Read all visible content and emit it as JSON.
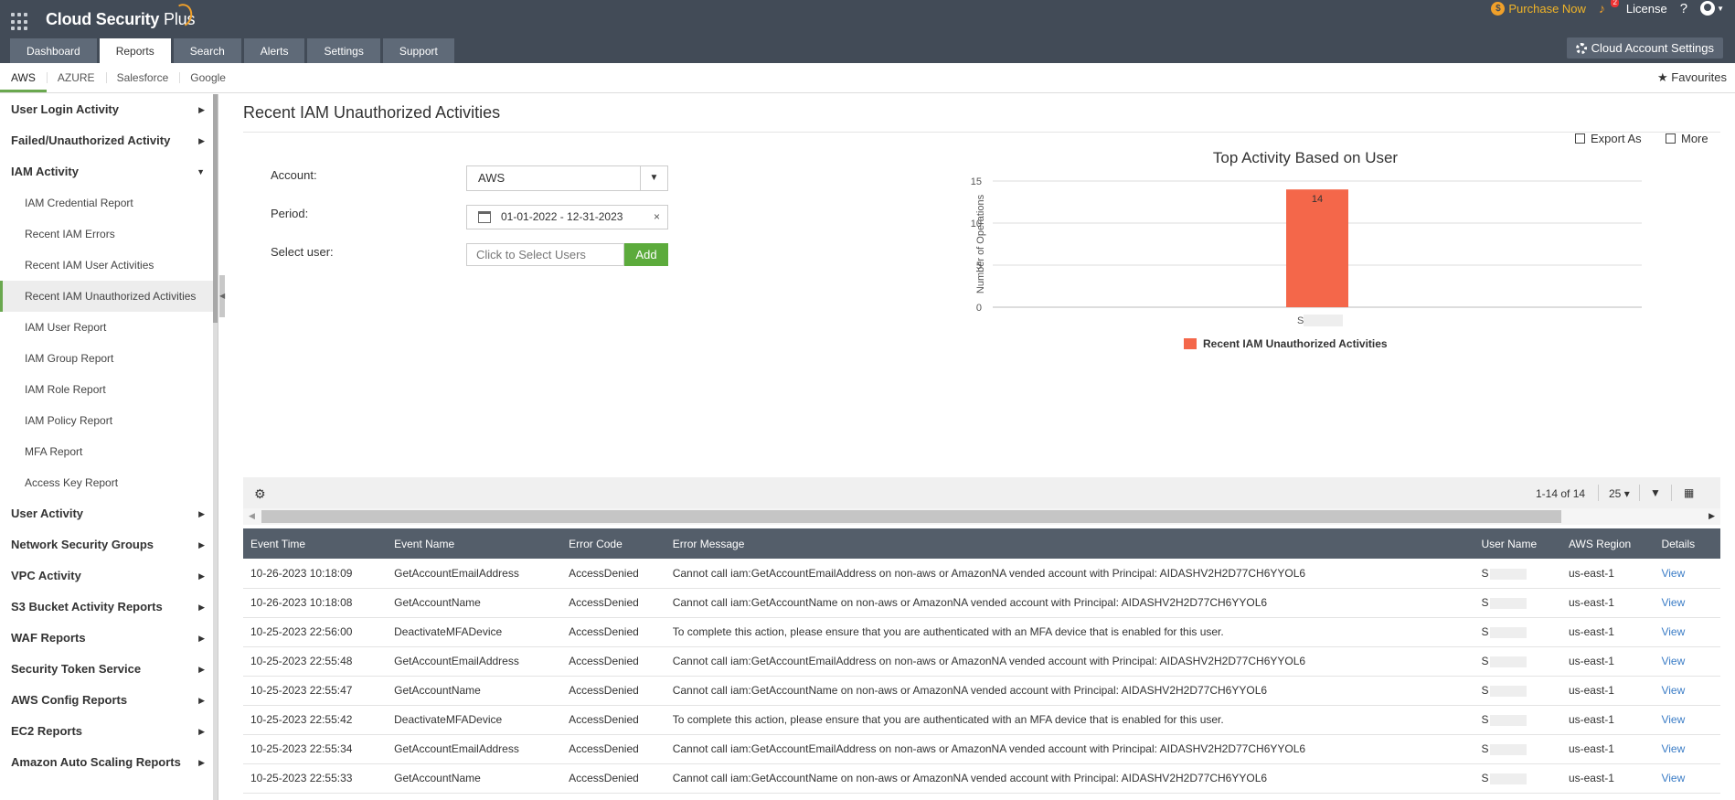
{
  "app": {
    "brand_main": "Cloud Security",
    "brand_plus": " Plus",
    "purchase_label": "Purchase Now",
    "license_label": "License",
    "help_label": "?"
  },
  "tabs": [
    {
      "label": "Dashboard"
    },
    {
      "label": "Reports"
    },
    {
      "label": "Search"
    },
    {
      "label": "Alerts"
    },
    {
      "label": "Settings"
    },
    {
      "label": "Support"
    }
  ],
  "cloud_settings_label": "Cloud Account Settings",
  "subtabs": [
    {
      "label": "AWS"
    },
    {
      "label": "AZURE"
    },
    {
      "label": "Salesforce"
    },
    {
      "label": "Google"
    }
  ],
  "favourites_label": "Favourites",
  "sidebar": {
    "categories": [
      {
        "label": "User Login Activity"
      },
      {
        "label": "Failed/Unauthorized Activity"
      },
      {
        "label": "IAM Activity"
      },
      {
        "label": "User Activity"
      },
      {
        "label": "Network Security Groups"
      },
      {
        "label": "VPC Activity"
      },
      {
        "label": "S3 Bucket Activity Reports"
      },
      {
        "label": "WAF Reports"
      },
      {
        "label": "Security Token Service"
      },
      {
        "label": "AWS Config Reports"
      },
      {
        "label": "EC2 Reports"
      },
      {
        "label": "Amazon Auto Scaling Reports"
      }
    ],
    "iam_items": [
      {
        "label": "IAM Credential Report"
      },
      {
        "label": "Recent IAM Errors"
      },
      {
        "label": "Recent IAM User Activities"
      },
      {
        "label": "Recent IAM Unauthorized Activities"
      },
      {
        "label": "IAM User Report"
      },
      {
        "label": "IAM Group Report"
      },
      {
        "label": "IAM Role Report"
      },
      {
        "label": "IAM Policy Report"
      },
      {
        "label": "MFA Report"
      },
      {
        "label": "Access Key Report"
      }
    ]
  },
  "page": {
    "title": "Recent IAM Unauthorized Activities"
  },
  "form": {
    "account_label": "Account:",
    "account_value": "AWS",
    "period_label": "Period:",
    "period_value": "01-01-2022 - 12-31-2023",
    "clear_symbol": "×",
    "select_user_label": "Select user:",
    "user_placeholder": "Click to Select Users",
    "add_label": "Add"
  },
  "chart_actions": {
    "export_label": "Export As",
    "more_label": "More"
  },
  "chart_data": {
    "type": "bar",
    "title": "Top Activity Based on User",
    "xlabel": "",
    "ylabel": "Number of Operations",
    "categories": [
      "S"
    ],
    "values": [
      14
    ],
    "ylim": [
      0,
      15
    ],
    "yticks": [
      0,
      5,
      10,
      15
    ],
    "series": [
      {
        "name": "Recent IAM Unauthorized Activities",
        "values": [
          14
        ]
      }
    ],
    "color": "#f4674a",
    "grid": true,
    "legend": "bottom"
  },
  "grid": {
    "page_info": "1-14 of 14",
    "page_size": "25",
    "columns": [
      "Event Time",
      "Event Name",
      "Error Code",
      "Error Message",
      "User Name",
      "AWS Region",
      "Details"
    ],
    "rows": [
      {
        "time": "10-26-2023 10:18:09",
        "event": "GetAccountEmailAddress",
        "code": "AccessDenied",
        "message": "Cannot call iam:GetAccountEmailAddress on non-aws or AmazonNA vended account with Principal: AIDASHV2H2D77CH6YYOL6",
        "user": "S",
        "region": "us-east-1",
        "details": "View"
      },
      {
        "time": "10-26-2023 10:18:08",
        "event": "GetAccountName",
        "code": "AccessDenied",
        "message": "Cannot call iam:GetAccountName on non-aws or AmazonNA vended account with Principal: AIDASHV2H2D77CH6YYOL6",
        "user": "S",
        "region": "us-east-1",
        "details": "View"
      },
      {
        "time": "10-25-2023 22:56:00",
        "event": "DeactivateMFADevice",
        "code": "AccessDenied",
        "message": "To complete this action, please ensure that you are authenticated with an MFA device that is enabled for this user.",
        "user": "S",
        "region": "us-east-1",
        "details": "View"
      },
      {
        "time": "10-25-2023 22:55:48",
        "event": "GetAccountEmailAddress",
        "code": "AccessDenied",
        "message": "Cannot call iam:GetAccountEmailAddress on non-aws or AmazonNA vended account with Principal: AIDASHV2H2D77CH6YYOL6",
        "user": "S",
        "region": "us-east-1",
        "details": "View"
      },
      {
        "time": "10-25-2023 22:55:47",
        "event": "GetAccountName",
        "code": "AccessDenied",
        "message": "Cannot call iam:GetAccountName on non-aws or AmazonNA vended account with Principal: AIDASHV2H2D77CH6YYOL6",
        "user": "S",
        "region": "us-east-1",
        "details": "View"
      },
      {
        "time": "10-25-2023 22:55:42",
        "event": "DeactivateMFADevice",
        "code": "AccessDenied",
        "message": "To complete this action, please ensure that you are authenticated with an MFA device that is enabled for this user.",
        "user": "S",
        "region": "us-east-1",
        "details": "View"
      },
      {
        "time": "10-25-2023 22:55:34",
        "event": "GetAccountEmailAddress",
        "code": "AccessDenied",
        "message": "Cannot call iam:GetAccountEmailAddress on non-aws or AmazonNA vended account with Principal: AIDASHV2H2D77CH6YYOL6",
        "user": "S",
        "region": "us-east-1",
        "details": "View"
      },
      {
        "time": "10-25-2023 22:55:33",
        "event": "GetAccountName",
        "code": "AccessDenied",
        "message": "Cannot call iam:GetAccountName on non-aws or AmazonNA vended account with Principal: AIDASHV2H2D77CH6YYOL6",
        "user": "S",
        "region": "us-east-1",
        "details": "View"
      }
    ]
  }
}
